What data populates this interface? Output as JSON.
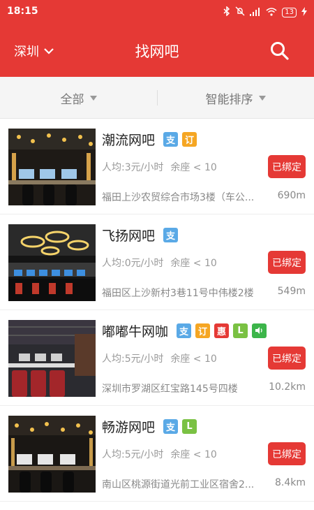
{
  "status": {
    "time": "18:15",
    "battery": "13"
  },
  "header": {
    "city": "深圳",
    "title": "找网吧"
  },
  "filters": {
    "all": "全部",
    "sort": "智能排序"
  },
  "colors": {
    "primary": "#e53935",
    "pay": "#5aa9e6",
    "order": "#f5a623",
    "promo": "#e53935",
    "lol": "#7ac143",
    "sound": "#3cb54a"
  },
  "cafes": [
    {
      "name": "潮流网吧",
      "price": "人均:3元/小时",
      "seats": "余座 < 10",
      "bind": "已绑定",
      "addr": "福田上沙农贸综合市场3楼（车公...",
      "dist": "690m",
      "badges": [
        {
          "icon": "pay-badge",
          "text": "支"
        },
        {
          "icon": "order-badge",
          "text": "订"
        }
      ]
    },
    {
      "name": "飞扬网吧",
      "price": "人均:0元/小时",
      "seats": "余座 < 10",
      "bind": "已绑定",
      "addr": "福田区上沙新村3巷11号中伟楼2楼",
      "dist": "549m",
      "badges": [
        {
          "icon": "pay-badge",
          "text": "支"
        }
      ]
    },
    {
      "name": "嘟嘟牛网咖",
      "price": "人均:5元/小时",
      "seats": "余座 < 10",
      "bind": "已绑定",
      "addr": "深圳市罗湖区红宝路145号四楼",
      "dist": "10.2km",
      "badges": [
        {
          "icon": "pay-badge",
          "text": "支"
        },
        {
          "icon": "order-badge",
          "text": "订"
        },
        {
          "icon": "promo-badge",
          "text": "惠"
        },
        {
          "icon": "lol-badge",
          "text": "L"
        },
        {
          "icon": "sound-badge",
          "text": ""
        }
      ]
    },
    {
      "name": "畅游网吧",
      "price": "人均:5元/小时",
      "seats": "余座 < 10",
      "bind": "已绑定",
      "addr": "南山区桃源街道光前工业区宿舍2...",
      "dist": "8.4km",
      "badges": [
        {
          "icon": "pay-badge",
          "text": "支"
        },
        {
          "icon": "lol-badge",
          "text": "L"
        }
      ]
    }
  ]
}
